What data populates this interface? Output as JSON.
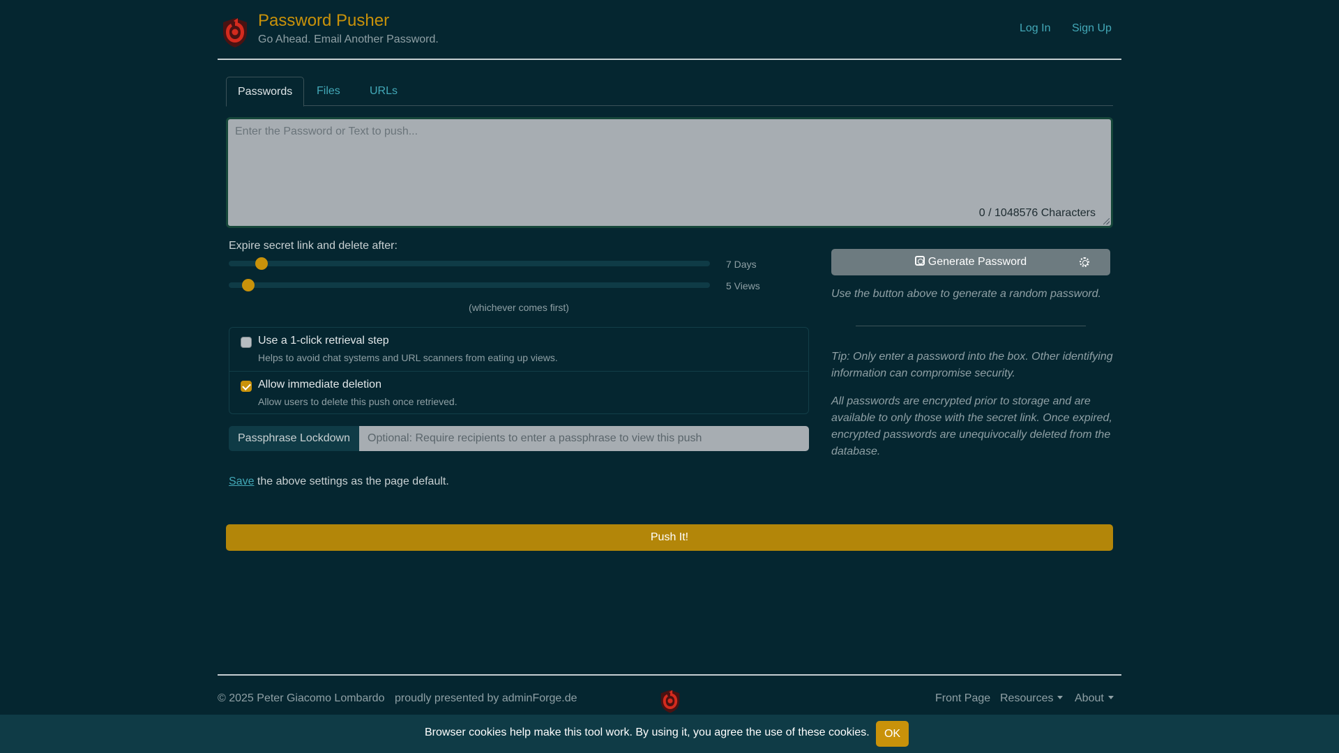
{
  "header": {
    "title": "Password Pusher",
    "tagline": "Go Ahead. Email Another Password.",
    "login_label": "Log In",
    "signup_label": "Sign Up"
  },
  "tabs": [
    {
      "label": "Passwords",
      "active": true
    },
    {
      "label": "Files",
      "active": false
    },
    {
      "label": "URLs",
      "active": false
    }
  ],
  "secret": {
    "placeholder": "Enter the Password or Text to push...",
    "value": "",
    "char_count": "0 / 1048576 Characters"
  },
  "expiration": {
    "label": "Expire secret link and delete after:",
    "days_label": "7 Days",
    "days_value": 7,
    "days_min": 1,
    "days_max": 90,
    "views_label": "5 Views",
    "views_value": 5,
    "views_min": 1,
    "views_max": 100,
    "note": "(whichever comes first)"
  },
  "options": [
    {
      "title": "Use a 1-click retrieval step",
      "help": "Helps to avoid chat systems and URL scanners from eating up views.",
      "checked": false
    },
    {
      "title": "Allow immediate deletion",
      "help": "Allow users to delete this push once retrieved.",
      "checked": true
    }
  ],
  "passphrase": {
    "label": "Passphrase Lockdown",
    "placeholder": "Optional: Require recipients to enter a passphrase to view this push"
  },
  "save": {
    "link_label": "Save",
    "text": " the above settings as the page default."
  },
  "generator": {
    "button_label": "Generate Password",
    "help": "Use the button above to generate a random password."
  },
  "tips": {
    "tip1": "Tip: Only enter a password into the box. Other identifying information can compromise security.",
    "tip2": "All passwords are encrypted prior to storage and are available to only those with the secret link. Once expired, encrypted passwords are unequivocally deleted from the database."
  },
  "push_label": "Push It!",
  "footer": {
    "copyright": "© 2025 Peter Giacomo Lombardo",
    "presented": "proudly presented by adminForge.de",
    "front_page": "Front Page",
    "resources": "Resources",
    "about": "About"
  },
  "cookie": {
    "text": "Browser cookies help make this tool work. By using it, you agree the use of these cookies.",
    "ok_label": "OK"
  },
  "colors": {
    "background": "#052630",
    "accent": "#c9920a",
    "link": "#43a9b8",
    "logo_red": "#d42b1e"
  },
  "icons": {
    "logo": "shield-eye-logo",
    "generate": "cpu-icon",
    "settings": "gear-icon"
  }
}
